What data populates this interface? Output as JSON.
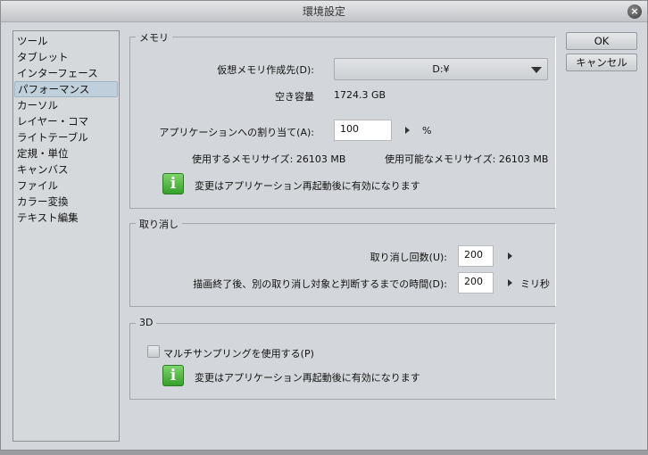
{
  "window": {
    "title": "環境設定",
    "close_icon": "close-icon"
  },
  "sidebar": {
    "items": [
      {
        "label": "ツール"
      },
      {
        "label": "タブレット"
      },
      {
        "label": "インターフェース"
      },
      {
        "label": "パフォーマンス",
        "selected": true
      },
      {
        "label": "カーソル"
      },
      {
        "label": "レイヤー・コマ"
      },
      {
        "label": "ライトテーブル"
      },
      {
        "label": "定規・単位"
      },
      {
        "label": "キャンバス"
      },
      {
        "label": "ファイル"
      },
      {
        "label": "カラー変換"
      },
      {
        "label": "テキスト編集"
      }
    ]
  },
  "memory": {
    "legend": "メモリ",
    "vm_label": "仮想メモリ作成先(D):",
    "vm_value": "D:¥",
    "free_label": "空き容量",
    "free_value": "1724.3 GB",
    "alloc_label": "アプリケーションへの割り当て(A):",
    "alloc_value": "100",
    "alloc_unit": "%",
    "used_label": "使用するメモリサイズ: 26103 MB",
    "avail_label": "使用可能なメモリサイズ: 26103 MB",
    "notice": "変更はアプリケーション再起動後に有効になります",
    "info_glyph": "i"
  },
  "undo": {
    "legend": "取り消し",
    "count_label": "取り消し回数(U):",
    "count_value": "200",
    "time_label": "描画終了後、別の取り消し対象と判断するまでの時間(D):",
    "time_value": "200",
    "time_unit": "ミリ秒"
  },
  "three_d": {
    "legend": "3D",
    "multisample_label": "マルチサンプリングを使用する(P)",
    "multisample_checked": false,
    "notice": "変更はアプリケーション再起動後に有効になります",
    "info_glyph": "i"
  },
  "buttons": {
    "ok": "OK",
    "cancel": "キャンセル"
  }
}
